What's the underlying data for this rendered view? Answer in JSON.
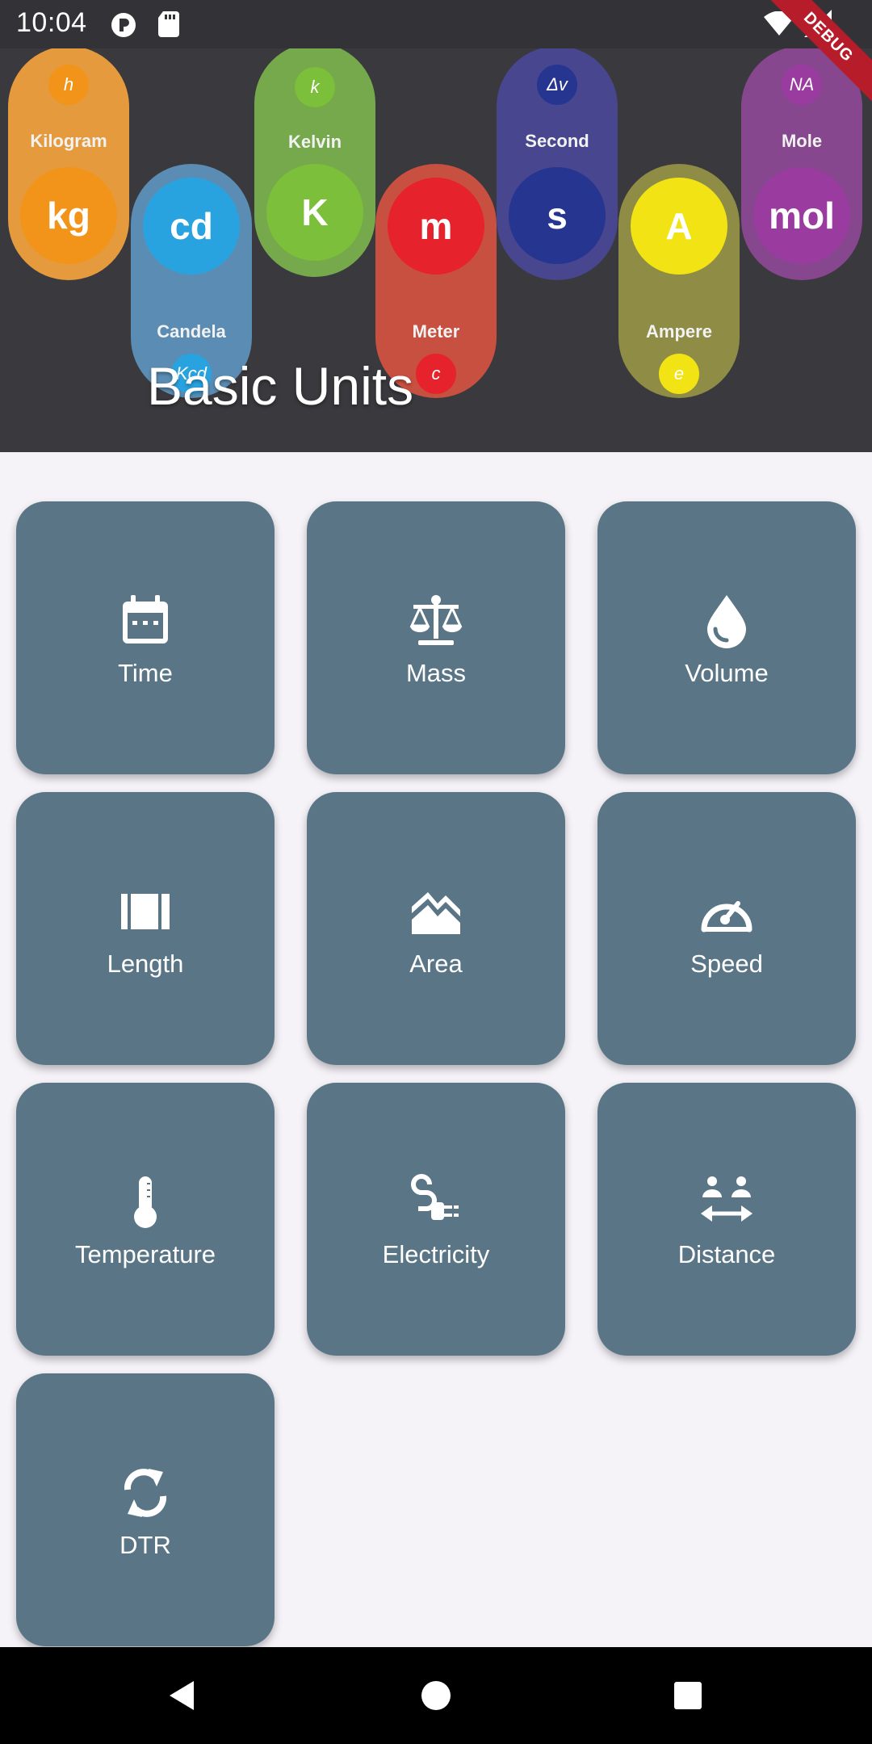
{
  "status_bar": {
    "time": "10:04",
    "icons": [
      "circle-p-icon",
      "sd-card-icon",
      "wifi-icon",
      "signal-icon"
    ],
    "debug_banner": "DEBUG"
  },
  "header": {
    "title": "Basic Units",
    "colors": {
      "background": "#3a393d"
    },
    "units": [
      {
        "name": "Kilogram",
        "symbol": "kg",
        "constant": "h",
        "color": "#e59a3d",
        "circle_color": "#f29419"
      },
      {
        "name": "Candela",
        "symbol": "cd",
        "constant": "Kcd",
        "color": "#5b8db4",
        "circle_color": "#29a3df"
      },
      {
        "name": "Kelvin",
        "symbol": "K",
        "constant": "k",
        "color": "#76a84c",
        "circle_color": "#7bbf3a"
      },
      {
        "name": "Meter",
        "symbol": "m",
        "constant": "c",
        "color": "#c75040",
        "circle_color": "#e6232c"
      },
      {
        "name": "Second",
        "symbol": "s",
        "constant": "Δv",
        "color": "#47468f",
        "circle_color": "#26358f"
      },
      {
        "name": "Ampere",
        "symbol": "A",
        "constant": "e",
        "color": "#8e8c45",
        "circle_color": "#f2e414"
      },
      {
        "name": "Mole",
        "symbol": "mol",
        "constant": "NA",
        "color": "#86478e",
        "circle_color": "#9a3ba0"
      }
    ]
  },
  "grid": {
    "tile_color": "#5a7686",
    "tiles": [
      {
        "label": "Time",
        "icon": "calendar-icon"
      },
      {
        "label": "Mass",
        "icon": "scale-icon"
      },
      {
        "label": "Volume",
        "icon": "water-drop-icon"
      },
      {
        "label": "Length",
        "icon": "ruler-icon"
      },
      {
        "label": "Area",
        "icon": "terrain-icon"
      },
      {
        "label": "Speed",
        "icon": "speedometer-icon"
      },
      {
        "label": "Temperature",
        "icon": "thermometer-icon"
      },
      {
        "label": "Electricity",
        "icon": "power-plug-icon"
      },
      {
        "label": "Distance",
        "icon": "distance-icon"
      },
      {
        "label": "DTR",
        "icon": "refresh-icon"
      }
    ]
  },
  "nav_bar": {
    "buttons": [
      "back",
      "home",
      "recents"
    ]
  }
}
